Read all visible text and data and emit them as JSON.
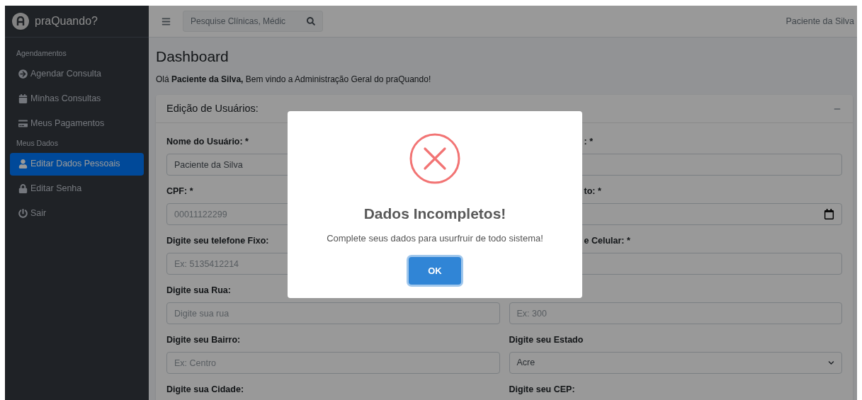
{
  "sidebar": {
    "brand": "praQuando?",
    "sections": [
      {
        "header": "Agendamentos",
        "items": [
          {
            "label": "Agendar Consulta",
            "selected": false
          },
          {
            "label": "Minhas Consultas",
            "selected": false
          },
          {
            "label": "Meus Pagamentos",
            "selected": false
          }
        ]
      },
      {
        "header": "Meus Dados",
        "items": [
          {
            "label": "Editar Dados Pessoais",
            "selected": true
          },
          {
            "label": "Editar Senha",
            "selected": false
          },
          {
            "label": "Sair",
            "selected": false
          }
        ]
      }
    ]
  },
  "navbar": {
    "search": {
      "placeholder": "Pesquise Clínicas, Médic"
    },
    "user": "Paciente da Silva"
  },
  "page": {
    "title": "Dashboard",
    "greeting": "Olá **Paciente da Silva,** Bem vindo a Administração Geral do praQuando!"
  },
  "card": {
    "title": "Edição de Usuários:",
    "rows": [
      [
        {
          "label": "Nome do Usuário: *",
          "kind": "text",
          "value": "Paciente da Silva"
        },
        {
          "label": ": *",
          "kind": "text",
          "partial": true
        }
      ],
      [
        {
          "label": "CPF: *",
          "kind": "text",
          "placeholder": "00011122299"
        },
        {
          "label": "to: *",
          "kind": "date",
          "partial": true
        }
      ],
      [
        {
          "label": "Digite seu telefone Fixo:",
          "kind": "text",
          "placeholder": "Ex: 5135412214"
        },
        {
          "label": "e Celular: *",
          "kind": "text",
          "partial": true
        }
      ],
      [
        {
          "label": "Digite sua Rua:",
          "kind": "text",
          "placeholder": "Digite sua rua"
        },
        {
          "kind": "text",
          "placeholder": "Ex: 300"
        }
      ],
      [
        {
          "label": "Digite seu Bairro:",
          "kind": "text",
          "placeholder": "Ex: Centro"
        },
        {
          "label": "Digite seu Estado",
          "kind": "select",
          "value": "Acre"
        }
      ],
      [
        {
          "label": "Digite sua Cidade:",
          "kind": "none"
        },
        {
          "label": "Digite seu CEP:",
          "kind": "none"
        }
      ]
    ]
  },
  "dialog": {
    "title": "Dados Incompletos!",
    "message": "Complete seus dados para usurfruir de todo sistema!",
    "button": "OK"
  }
}
